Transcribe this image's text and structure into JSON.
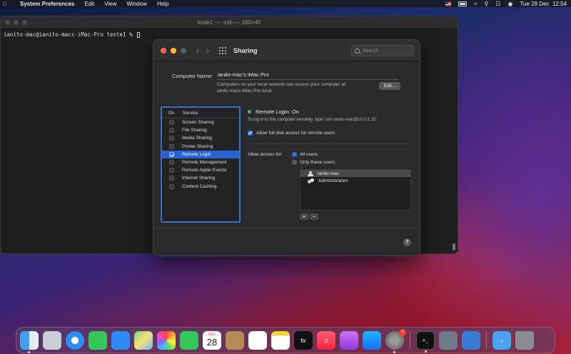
{
  "menubar": {
    "app_name": "System Preferences",
    "items": [
      "Edit",
      "View",
      "Window",
      "Help"
    ],
    "clock": "Tue 28 Dec  12:54"
  },
  "terminal": {
    "title": "teste1 — -zsh — 160×40",
    "prompt": "ianito-mac@ianito-macs-iMac-Pro teste1 %"
  },
  "sharing": {
    "title": "Sharing",
    "search_placeholder": "Search",
    "computer_name_label": "Computer Name:",
    "computer_name": "ianito-mac's iMac Pro",
    "network_info_line1": "Computers on your local network can access your computer at:",
    "network_info_line2": "ianito-macs-iMac-Pro.local",
    "edit_button": "Edit...",
    "table_headers": {
      "on": "On",
      "service": "Service"
    },
    "services": [
      {
        "label": "Screen Sharing",
        "checked": false
      },
      {
        "label": "File Sharing",
        "checked": false
      },
      {
        "label": "Media Sharing",
        "checked": false
      },
      {
        "label": "Printer Sharing",
        "checked": false
      },
      {
        "label": "Remote Login",
        "checked": true
      },
      {
        "label": "Remote Management",
        "checked": false
      },
      {
        "label": "Remote Apple Events",
        "checked": false
      },
      {
        "label": "Internet Sharing",
        "checked": false
      },
      {
        "label": "Content Caching",
        "checked": false
      }
    ],
    "status": "Remote Login: On",
    "login_hint": "To log in to this computer remotely, type \"ssh ianito-mac@10.0.2.15\".",
    "full_disk_access": "Allow full disk access for remote users",
    "allow_access_label": "Allow access for:",
    "all_users": "All users",
    "only_these_users": "Only these users:",
    "users": [
      "ianito-mac",
      "Administrators"
    ],
    "plus": "+",
    "minus": "−",
    "help": "?"
  },
  "dock": {
    "calendar_month": "DEC",
    "calendar_day": "28",
    "tv_label": "tv",
    "settings_badge": "2",
    "terminal_glyph": ">_",
    "apps": [
      "finder",
      "launchpad",
      "safari",
      "messages",
      "mail",
      "maps",
      "photos",
      "facetime",
      "calendar",
      "contacts",
      "reminders",
      "notes",
      "tv",
      "music",
      "podcasts",
      "app-store",
      "system-preferences",
      "terminal",
      "script-editor",
      "xcode-instruments",
      "downloads",
      "trash"
    ]
  },
  "colors": {
    "accent": "#2963d3",
    "status_green": "#34c759"
  }
}
